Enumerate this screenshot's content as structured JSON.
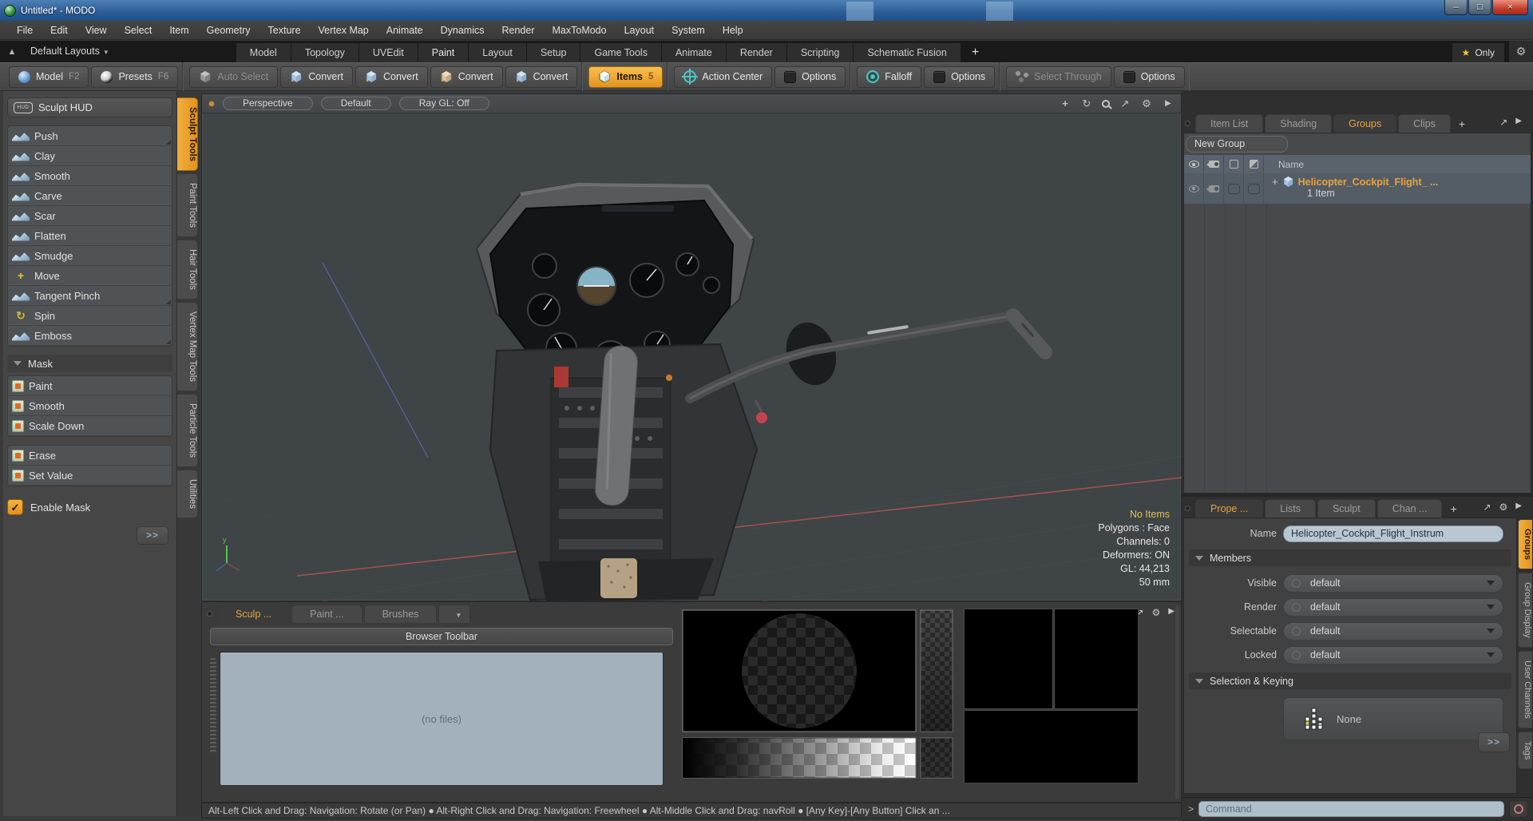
{
  "window": {
    "title": "Untitled* - MODO",
    "controls": {
      "minimize": "–",
      "restore": "□",
      "close": "×"
    }
  },
  "menubar": [
    "File",
    "Edit",
    "View",
    "Select",
    "Item",
    "Geometry",
    "Texture",
    "Vertex Map",
    "Animate",
    "Dynamics",
    "Render",
    "MaxToModo",
    "Layout",
    "System",
    "Help"
  ],
  "layout_bar": {
    "up_icon": "▲",
    "switcher": "Default Layouts",
    "tabs": [
      {
        "label": "Model"
      },
      {
        "label": "Topology"
      },
      {
        "label": "UVEdit"
      },
      {
        "label": "Paint",
        "active": true
      },
      {
        "label": "Layout"
      },
      {
        "label": "Setup"
      },
      {
        "label": "Game Tools"
      },
      {
        "label": "Animate"
      },
      {
        "label": "Render"
      },
      {
        "label": "Scripting"
      },
      {
        "label": "Schematic Fusion"
      }
    ],
    "add_tab": "+",
    "favorites_star": "★",
    "favorites": "Only",
    "gear": "⚙"
  },
  "toolbar": {
    "model": {
      "label": "Model",
      "key": "F2"
    },
    "presets": {
      "label": "Presets",
      "key": "F6"
    },
    "auto_select": {
      "label": "Auto Select"
    },
    "convert_vertex": {
      "label": "Convert"
    },
    "convert_edge": {
      "label": "Convert"
    },
    "convert_polygon": {
      "label": "Convert"
    },
    "convert_item": {
      "label": "Convert"
    },
    "items": {
      "label": "Items",
      "key": "5"
    },
    "action_center": {
      "label": "Action Center"
    },
    "action_options": {
      "label": "Options"
    },
    "falloff": {
      "label": "Falloff"
    },
    "falloff_options": {
      "label": "Options"
    },
    "select_through": {
      "label": "Select Through"
    },
    "select_options": {
      "label": "Options"
    }
  },
  "sidebar": {
    "hud_label": "Sculpt HUD",
    "hud_icon_text": "HUD",
    "tools": [
      {
        "label": "Push",
        "icon": "wave",
        "cls": "fold"
      },
      {
        "label": "Clay",
        "icon": "wave"
      },
      {
        "label": "Smooth",
        "icon": "wave"
      },
      {
        "label": "Carve",
        "icon": "wave"
      },
      {
        "label": "Scar",
        "icon": "wave"
      },
      {
        "label": "Flatten",
        "icon": "wave"
      },
      {
        "label": "Smudge",
        "icon": "wave"
      },
      {
        "label": "Move",
        "icon": "move",
        "glyph": "+"
      },
      {
        "label": "Tangent Pinch",
        "icon": "wave",
        "cls": "fold"
      },
      {
        "label": "Spin",
        "icon": "spin",
        "glyph": "↻"
      },
      {
        "label": "Emboss",
        "icon": "wave",
        "cls": "fold"
      }
    ],
    "mask_header": "Mask",
    "mask_tools": [
      {
        "label": "Paint"
      },
      {
        "label": "Smooth"
      },
      {
        "label": "Scale Down"
      }
    ],
    "mask_ops": [
      {
        "label": "Erase"
      },
      {
        "label": "Set Value",
        "cls": "solid-ic"
      }
    ],
    "enable_mask": "Enable Mask",
    "enable_check": "✓",
    "more": ">>"
  },
  "tool_tabs": [
    {
      "label": "Sculpt Tools",
      "active": true
    },
    {
      "label": "Paint Tools"
    },
    {
      "label": "Hair Tools"
    },
    {
      "label": "Vertex Map Tools"
    },
    {
      "label": "Particle Tools"
    },
    {
      "label": "Utilities"
    }
  ],
  "viewport": {
    "projection": "Perspective",
    "shading": "Default",
    "raygl": "Ray GL: Off",
    "nav_icons": {
      "pan": "+",
      "orbit": "↻",
      "expand": "↗",
      "gear": "⚙",
      "play": "▶"
    },
    "info": [
      {
        "text": "No Items",
        "cls": "warn"
      },
      {
        "text": "Polygons : Face"
      },
      {
        "text": "Channels: 0"
      },
      {
        "text": "Deformers: ON"
      },
      {
        "text": "GL: 44,213"
      },
      {
        "text": "50 mm"
      }
    ]
  },
  "browser": {
    "tabs": [
      {
        "label": "Sculp ...",
        "active": true
      },
      {
        "label": "Paint ..."
      },
      {
        "label": "Brushes"
      }
    ],
    "brushes_caret": "▼",
    "icons": {
      "expand": "↗",
      "gear": "⚙",
      "play": "▶"
    },
    "toolbar_label": "Browser Toolbar",
    "empty_text": "(no files)"
  },
  "item_panel": {
    "tabs": [
      {
        "label": "Item List"
      },
      {
        "label": "Shading"
      },
      {
        "label": "Groups",
        "active": true
      },
      {
        "label": "Clips"
      }
    ],
    "add_tab": "+",
    "icons": {
      "expand": "↗",
      "play": "▶"
    },
    "new_group": "New Group",
    "name_col": "Name",
    "row": {
      "expand": "+",
      "name": "Helicopter_Cockpit_Flight_ ...",
      "count": "1 Item"
    }
  },
  "properties": {
    "tabs": [
      {
        "label": "Prope ...",
        "active": true
      },
      {
        "label": "Lists"
      },
      {
        "label": "Sculpt"
      },
      {
        "label": "Chan ..."
      }
    ],
    "add_tab": "+",
    "icons": {
      "expand": "↗",
      "gear": "⚙",
      "play": "▶"
    },
    "name_label": "Name",
    "name_value": "Helicopter_Cockpit_Flight_Instrum",
    "members_header": "Members",
    "rows": [
      {
        "label": "Visible",
        "value": "default"
      },
      {
        "label": "Render",
        "value": "default"
      },
      {
        "label": "Selectable",
        "value": "default"
      },
      {
        "label": "Locked",
        "value": "default"
      }
    ],
    "selection_header": "Selection & Keying",
    "none_button": "None",
    "more": ">>"
  },
  "side_tabs": [
    {
      "label": "Groups",
      "active": true
    },
    {
      "label": "Group Display"
    },
    {
      "label": "User Channels"
    },
    {
      "label": "Tags"
    }
  ],
  "command_bar": {
    "prompt": ">",
    "placeholder": "Command"
  },
  "status_bar": {
    "text": "Alt-Left Click and Drag: Navigation: Rotate (or Pan) ● Alt-Right Click and Drag: Navigation: Freewheel ● Alt-Middle Click and Drag: navRoll ● [Any Key]-[Any Button] Click an ..."
  },
  "colors": {
    "accent_orange": "#e9a13b",
    "warn_yellow": "#e0c050",
    "viewport_bg": "#3f4446"
  }
}
